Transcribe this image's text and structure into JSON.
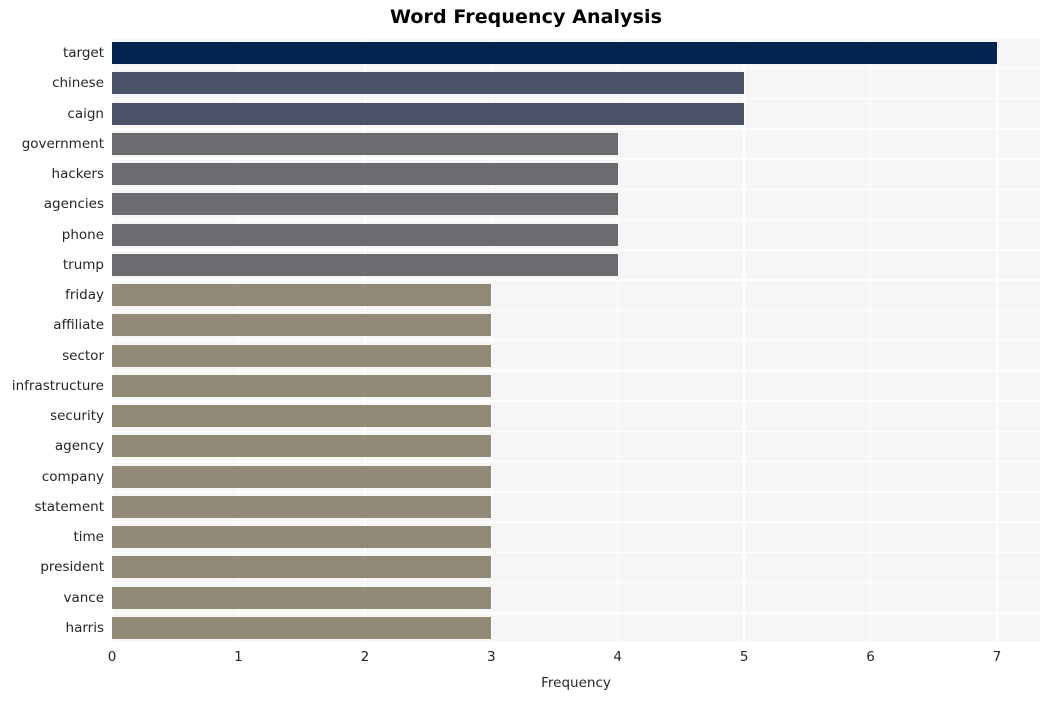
{
  "chart_data": {
    "type": "bar",
    "orientation": "horizontal",
    "title": "Word Frequency Analysis",
    "xlabel": "Frequency",
    "ylabel": "",
    "xlim": [
      0,
      7.34
    ],
    "xticks": [
      0,
      1,
      2,
      3,
      4,
      5,
      6,
      7
    ],
    "xtick_labels": [
      "0",
      "1",
      "2",
      "3",
      "4",
      "5",
      "6",
      "7"
    ],
    "grid": true,
    "grid_color": "#ffffff",
    "plot_background": "#f6f6f6",
    "figure_background": "#ffffff",
    "legend": null,
    "categories": [
      "target",
      "chinese",
      "caign",
      "government",
      "hackers",
      "agencies",
      "phone",
      "trump",
      "friday",
      "affiliate",
      "sector",
      "infrastructure",
      "security",
      "agency",
      "company",
      "statement",
      "time",
      "president",
      "vance",
      "harris"
    ],
    "values": [
      7,
      5,
      5,
      4,
      4,
      4,
      4,
      4,
      3,
      3,
      3,
      3,
      3,
      3,
      3,
      3,
      3,
      3,
      3,
      3
    ],
    "bar_colors": [
      "#042350",
      "#4b5267",
      "#4b5267",
      "#6b6c70",
      "#6b6c70",
      "#6b6c70",
      "#6b6c70",
      "#6b6c70",
      "#918a77",
      "#918a77",
      "#918a77",
      "#918a77",
      "#918a77",
      "#918a77",
      "#918a77",
      "#918a77",
      "#918a77",
      "#918a77",
      "#918a77",
      "#918a77"
    ]
  }
}
